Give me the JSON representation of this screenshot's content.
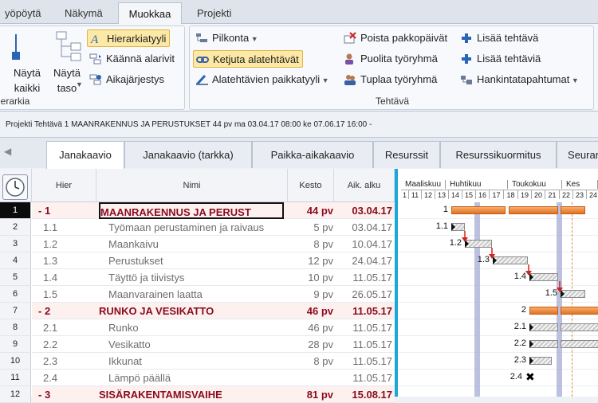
{
  "menu": {
    "tabs": [
      "yöpöytä",
      "Näkymä",
      "Muokkaa",
      "Projekti"
    ],
    "active": 2
  },
  "ribbon": {
    "hierarchy_group": {
      "title": "erarkia",
      "show_all_label": "Näytä\nkaikki",
      "show_level_label": "Näytä\ntaso",
      "buttons": [
        "Hierarkiatyyli",
        "Käännä alarivit",
        "Aikajärjestys"
      ]
    },
    "tasks_group": {
      "title": "Tehtävä",
      "col1": [
        "Pilkonta",
        "Ketjuta alatehtävät",
        "Alatehtävien paikkatyyli"
      ],
      "col2": [
        "Poista pakkopäivät",
        "Puolita työryhmä",
        "Tuplaa työryhmä"
      ],
      "col3": [
        "Lisää tehtävä",
        "Lisää tehtäviä",
        "Hankintatapahtumat"
      ]
    }
  },
  "infobar": {
    "text": "Projekti  Tehtävä 1  MAANRAKENNUS JA PERUSTUKSET  44 pv  ma 03.04.17 08:00  ke 07.06.17 16:00      -"
  },
  "view_tabs": [
    "Janakaavio",
    "Janakaavio (tarkka)",
    "Paikka-aikakaavio",
    "Resurssit",
    "Resurssikuormitus",
    "Seuran"
  ],
  "active_view": 0,
  "grid": {
    "headers": {
      "hier": "Hier",
      "name": "Nimi",
      "kesto": "Kesto",
      "alku": "Aik. alku"
    },
    "rows": [
      {
        "num": "1",
        "hier": "- 1",
        "name": "MAANRAKENNUS JA PERUST",
        "kesto": "44 pv",
        "alku": "03.04.17",
        "type": "sum",
        "selected": true
      },
      {
        "num": "2",
        "hier": "1.1",
        "name": "Työmaan perustaminen ja raivaus",
        "kesto": "5 pv",
        "alku": "03.04.17",
        "type": "sub"
      },
      {
        "num": "3",
        "hier": "1.2",
        "name": "Maankaivu",
        "kesto": "8 pv",
        "alku": "10.04.17",
        "type": "sub"
      },
      {
        "num": "4",
        "hier": "1.3",
        "name": "Perustukset",
        "kesto": "12 pv",
        "alku": "24.04.17",
        "type": "sub"
      },
      {
        "num": "5",
        "hier": "1.4",
        "name": "Täyttö ja tiivistys",
        "kesto": "10 pv",
        "alku": "11.05.17",
        "type": "sub"
      },
      {
        "num": "6",
        "hier": "1.5",
        "name": "Maanvarainen laatta",
        "kesto": "9 pv",
        "alku": "26.05.17",
        "type": "sub"
      },
      {
        "num": "7",
        "hier": "- 2",
        "name": "RUNKO JA VESIKATTO",
        "kesto": "46 pv",
        "alku": "11.05.17",
        "type": "sum"
      },
      {
        "num": "8",
        "hier": "2.1",
        "name": "Runko",
        "kesto": "46 pv",
        "alku": "11.05.17",
        "type": "sub"
      },
      {
        "num": "9",
        "hier": "2.2",
        "name": "Vesikatto",
        "kesto": "28 pv",
        "alku": "11.05.17",
        "type": "sub"
      },
      {
        "num": "10",
        "hier": "2.3",
        "name": "Ikkunat",
        "kesto": "8 pv",
        "alku": "11.05.17",
        "type": "sub"
      },
      {
        "num": "11",
        "hier": "2.4",
        "name": "Lämpö päällä",
        "kesto": "",
        "alku": "11.05.17",
        "type": "sub"
      },
      {
        "num": "12",
        "hier": "- 3",
        "name": "SISÄRAKENTAMISVAIHE",
        "kesto": "81 pv",
        "alku": "15.08.17",
        "type": "sum"
      }
    ]
  },
  "gantt": {
    "months": [
      "Maaliskuu",
      "Huhtikuu",
      "Toukokuu",
      "Kes"
    ],
    "days": [
      "1",
      "11",
      "12",
      "13",
      "14",
      "15",
      "16",
      "17",
      "18",
      "19",
      "20",
      "21",
      "22",
      "23",
      "24"
    ],
    "bars": [
      {
        "label": "1"
      },
      {
        "label": "1.1"
      },
      {
        "label": "1.2"
      },
      {
        "label": "1.3"
      },
      {
        "label": "1.4"
      },
      {
        "label": "1.5"
      },
      {
        "label": "2"
      },
      {
        "label": "2.1"
      },
      {
        "label": "2.2"
      },
      {
        "label": "2.3"
      },
      {
        "label": "2.4"
      }
    ],
    "summary_color": "#ea8030",
    "milestone_glyph": "✖"
  },
  "colors": {
    "accent": "#1aa8d8",
    "summary_text": "#8a0a1e",
    "highlight": "#fde9a6"
  }
}
